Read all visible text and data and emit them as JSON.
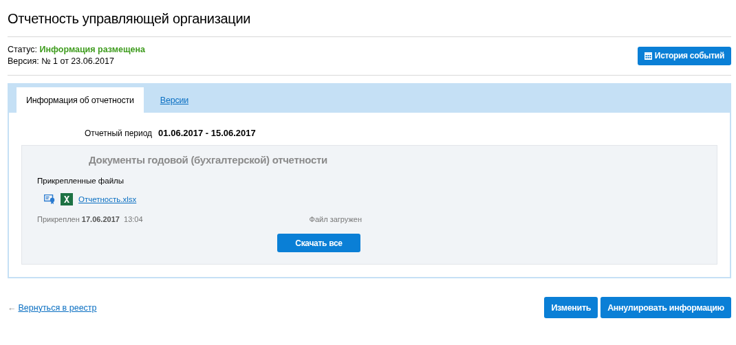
{
  "title": "Отчетность управляющей организации",
  "status": {
    "label": "Статус:",
    "value": "Информация размещена"
  },
  "version": "Версия: № 1 от 23.06.2017",
  "history_button": "История событий",
  "tabs": [
    {
      "label": "Информация об отчетности",
      "selected": true
    },
    {
      "label": "Версии",
      "selected": false
    }
  ],
  "period": {
    "label": "Отчетный период",
    "value": "01.06.2017 - 15.06.2017"
  },
  "section": {
    "title": "Документы годовой (бухгалтерской) отчетности",
    "files_label": "Прикрепленные файлы",
    "files": [
      {
        "name": "Отчетность.xlsx",
        "attached": "Прикреплен **17.06.2017**  13:04",
        "state": "Файл загружен"
      }
    ],
    "download_button": "Скачать все"
  },
  "back_link": {
    "icon": "←",
    "label": "Вернуться в реестр"
  },
  "buttons": [
    "Изменить",
    "Аннулировать информацию"
  ]
}
